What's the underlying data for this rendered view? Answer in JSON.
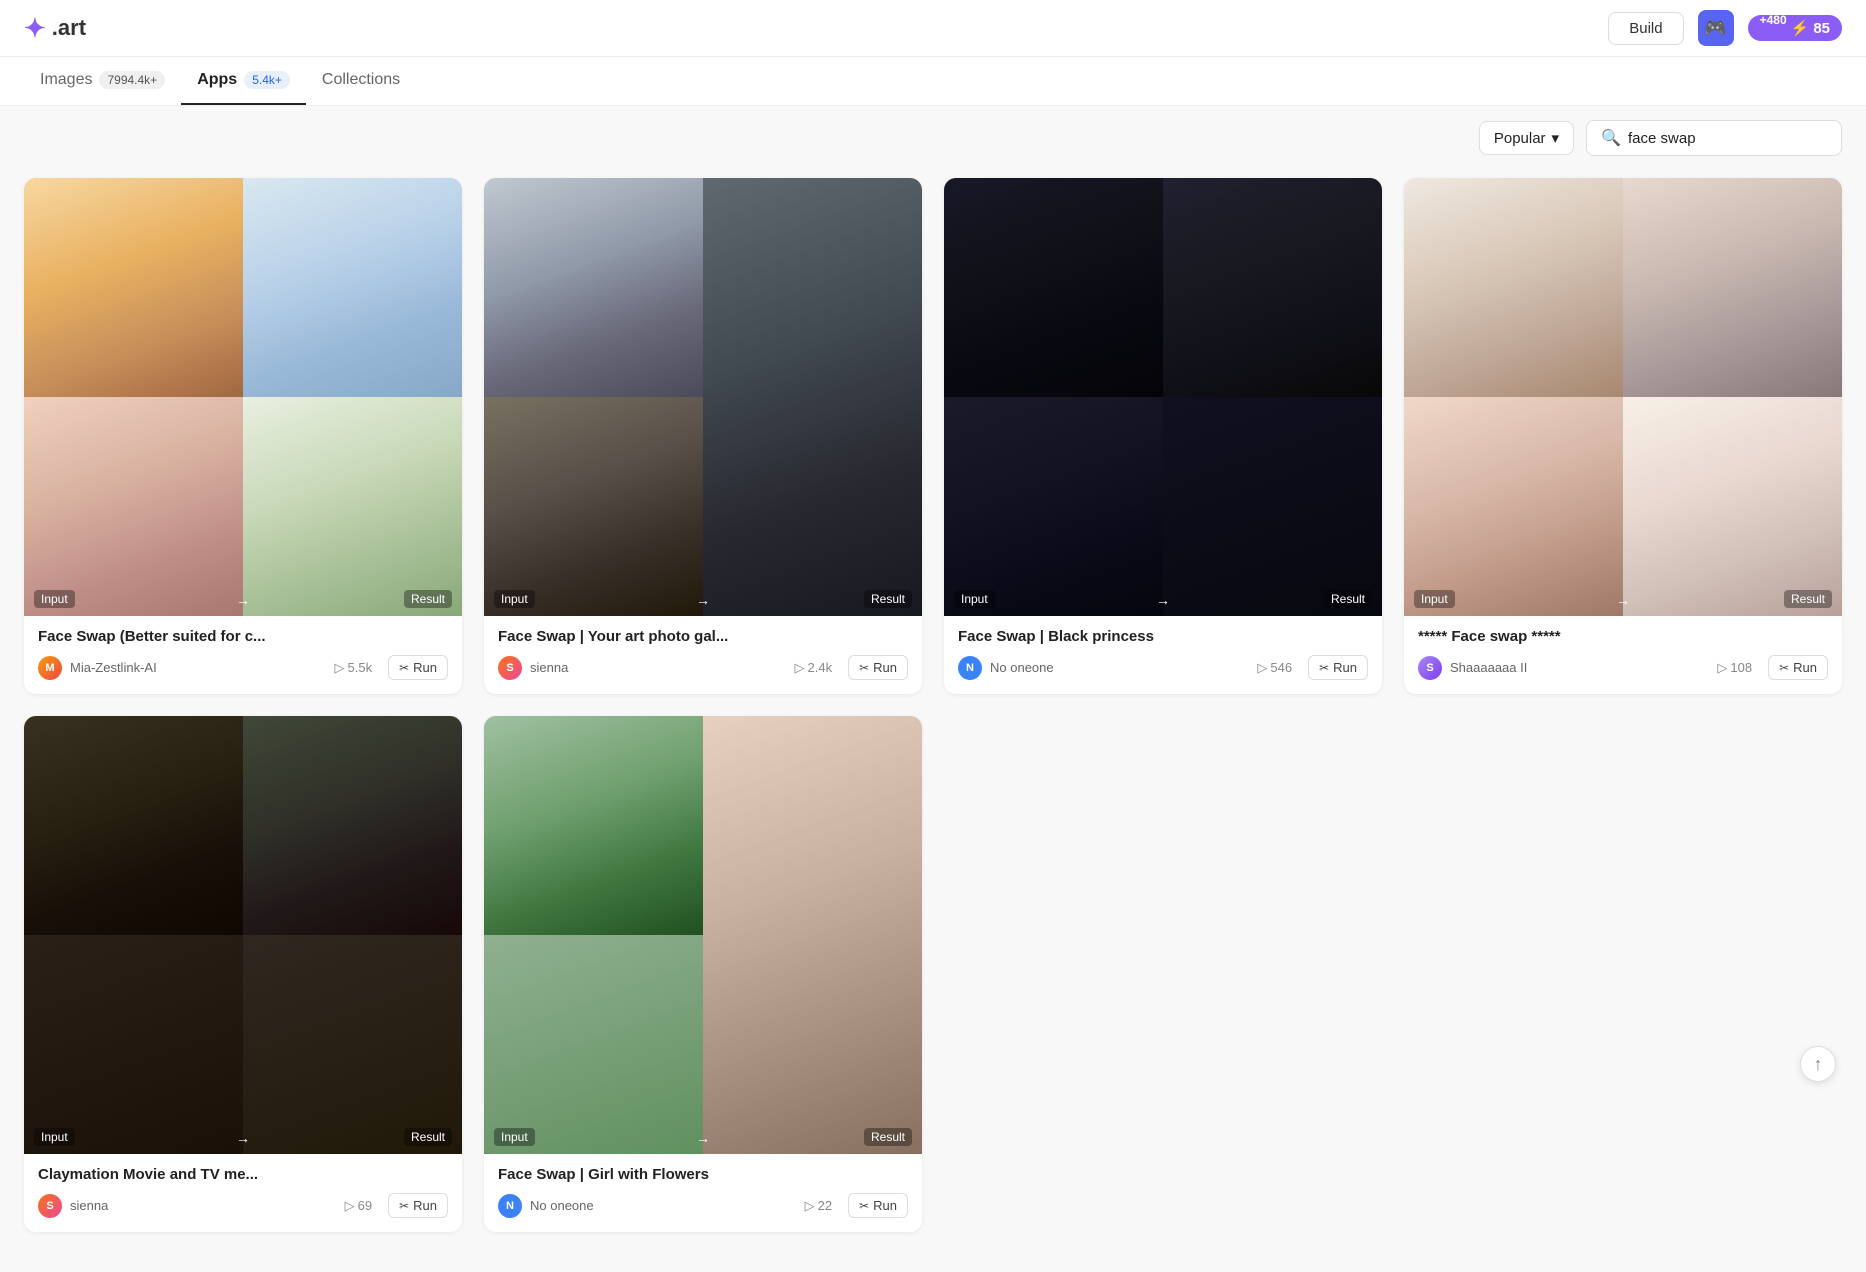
{
  "header": {
    "logo_text": ".art",
    "build_label": "Build",
    "credits_plus": "+480",
    "credits_amount": "85"
  },
  "tabs": [
    {
      "id": "images",
      "label": "Images",
      "badge": "7994.4k+",
      "badge_type": "gray",
      "active": false
    },
    {
      "id": "apps",
      "label": "Apps",
      "badge": "5.4k+",
      "badge_type": "blue",
      "active": true
    },
    {
      "id": "collections",
      "label": "Collections",
      "badge": "",
      "active": false
    }
  ],
  "filter": {
    "sort_label": "Popular",
    "search_placeholder": "face swap",
    "search_value": "face swap",
    "search_icon": "🔍"
  },
  "cards": [
    {
      "id": "card1",
      "title": "Face Swap  (Better suited for c...",
      "author": "Mia-Zestlink-AI",
      "avatar_type": "img",
      "views": "5.5k",
      "run_label": "Run",
      "layout": "2x2"
    },
    {
      "id": "card2",
      "title": "Face Swap | Your art photo gal...",
      "author": "sienna",
      "avatar_type": "img",
      "views": "2.4k",
      "run_label": "Run",
      "layout": "2col-bottom"
    },
    {
      "id": "card3",
      "title": "Face Swap | Black princess",
      "author": "No oneone",
      "avatar_type": "blue",
      "views": "546",
      "run_label": "Run",
      "layout": "2x2"
    },
    {
      "id": "card4",
      "title": "***** Face swap *****",
      "author": "Shaaaaaaa II",
      "avatar_type": "img",
      "views": "108",
      "run_label": "Run",
      "layout": "2x2"
    },
    {
      "id": "card5",
      "title": "Claymation Movie and TV me...",
      "author": "sienna",
      "avatar_type": "img",
      "views": "69",
      "run_label": "Run",
      "layout": "2x2"
    },
    {
      "id": "card6",
      "title": "Face Swap | Girl with Flowers",
      "author": "No oneone",
      "avatar_type": "blue",
      "views": "22",
      "run_label": "Run",
      "layout": "2col-bottom"
    }
  ],
  "labels": {
    "input": "Input",
    "result": "Result",
    "arrow": "→"
  }
}
